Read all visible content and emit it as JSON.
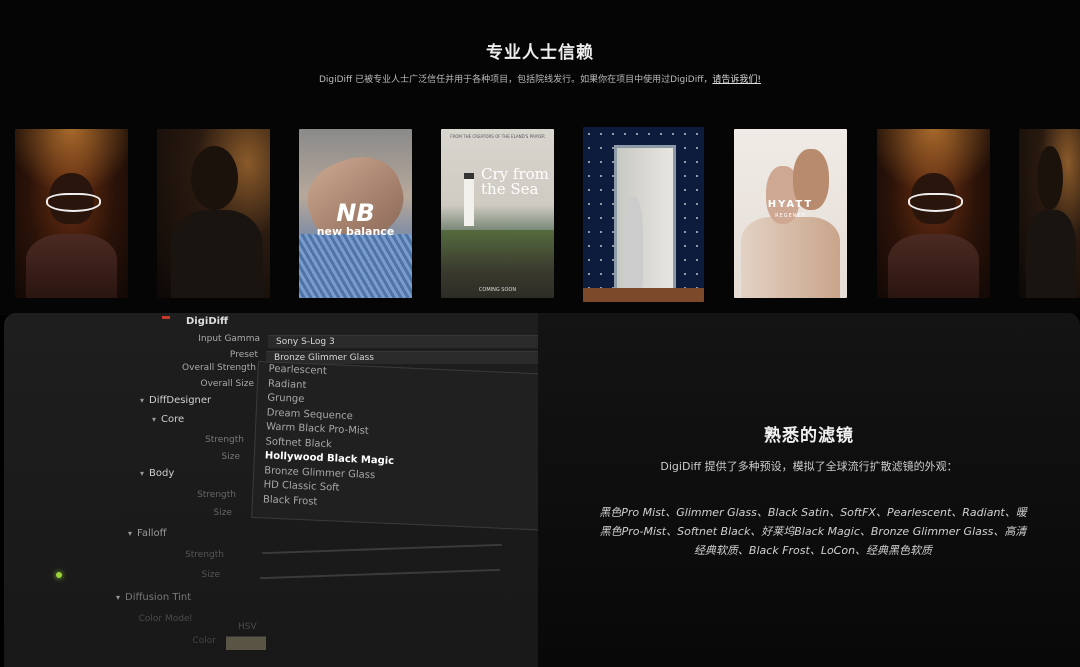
{
  "header": {
    "title": "专业人士信赖",
    "subtitle_prefix": "DigiDiff 已被专业人士广泛信任并用于各种项目，包括院线发行。如果你在项目中使用过DigiDiff，",
    "subtitle_link": "请告诉我们!"
  },
  "posters": [
    {
      "name": "poster-warm-portrait-1",
      "theme": "warm",
      "caption": ""
    },
    {
      "name": "poster-dark-portrait",
      "theme": "dark",
      "caption": ""
    },
    {
      "name": "poster-new-balance",
      "theme": "nb",
      "caption": "new balance"
    },
    {
      "name": "poster-cry-from-the-sea",
      "theme": "sea",
      "caption": "Cry from the Sea",
      "top_text": "FROM THE CREATORS OF THE ELAND'S PRAYER",
      "bottom_text": "COMING SOON"
    },
    {
      "name": "poster-door",
      "theme": "door",
      "caption": ""
    },
    {
      "name": "poster-hyatt",
      "theme": "hyatt",
      "caption": "HYATT",
      "sub": "REGENCY"
    },
    {
      "name": "poster-warm-portrait-2",
      "theme": "warm",
      "caption": ""
    },
    {
      "name": "poster-warm-portrait-3",
      "theme": "dark",
      "caption": ""
    }
  ],
  "plugin": {
    "name": "DigiDiff",
    "input_gamma_label": "Input Gamma",
    "input_gamma_value": "Sony S-Log 3",
    "preset_label": "Preset",
    "preset_value": "Bronze Glimmer Glass",
    "overall_strength_label": "Overall Strength",
    "overall_size_label": "Overall Size",
    "menu_items": [
      "Pearlescent",
      "Radiant",
      "Grunge",
      "Dream Sequence",
      "Warm Black Pro-Mist",
      "Softnet Black",
      "Hollywood Black Magic",
      "Bronze Glimmer Glass",
      "HD Classic Soft",
      "Black Frost"
    ],
    "selected_item": "Hollywood Black Magic",
    "sections": {
      "diffdesigner": "DiffDesigner",
      "core": "Core",
      "body": "Body",
      "falloff": "Falloff",
      "diffusion_tint": "Diffusion Tint"
    },
    "params": {
      "strength": "Strength",
      "size": "Size",
      "strength2": "Strength",
      "size2": "Size",
      "strength3": "Strength",
      "size3": "Size",
      "color_model": "Color Model",
      "color": "Color",
      "hsv": "HSV"
    }
  },
  "feature": {
    "title": "熟悉的滤镜",
    "subtitle": "DigiDiff 提供了多种预设，模拟了全球流行扩散滤镜的外观：",
    "list": "黑色Pro Mist、Glimmer Glass、Black Satin、SoftFX、Pearlescent、Radiant、暖黑色Pro-Mist、Softnet Black、好莱坞Black Magic、Bronze Glimmer Glass、高清经典软质、Black Frost、LoCon、经典黑色软质"
  }
}
